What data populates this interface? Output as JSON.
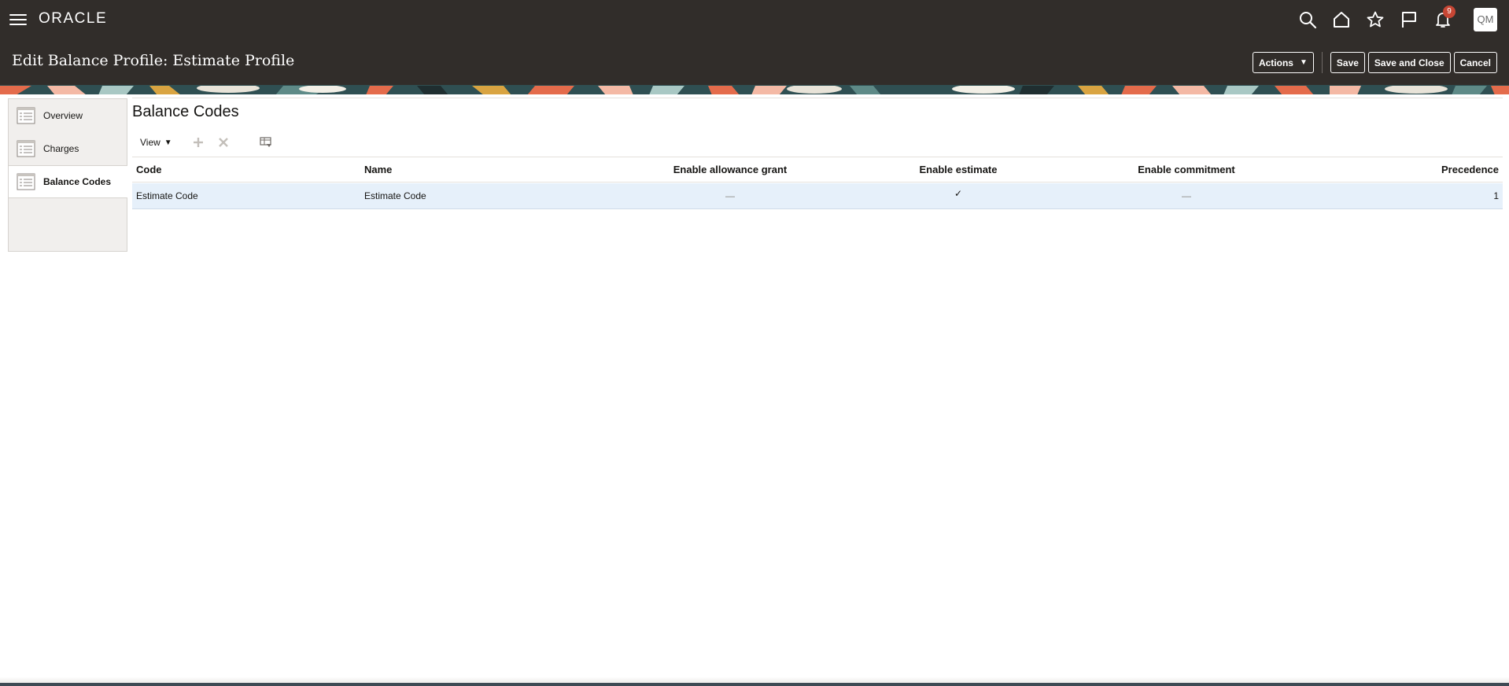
{
  "header": {
    "logo": "ORACLE",
    "notification_count": "9",
    "avatar_initials": "QM",
    "icons": [
      "search-icon",
      "home-icon",
      "favorites-star-icon",
      "flag-icon",
      "notifications-bell-icon"
    ]
  },
  "title_bar": {
    "title": "Edit Balance Profile: Estimate Profile",
    "actions_label": "Actions",
    "save_label": "Save",
    "save_close_label": "Save and Close",
    "cancel_label": "Cancel"
  },
  "left_nav": {
    "items": [
      {
        "label": "Overview"
      },
      {
        "label": "Charges"
      },
      {
        "label": "Balance Codes"
      }
    ],
    "active_index": 2
  },
  "main": {
    "section_title": "Balance Codes",
    "toolbar": {
      "view_label": "View"
    },
    "table": {
      "headers": {
        "code": "Code",
        "name": "Name",
        "allowance": "Enable allowance grant",
        "estimate": "Enable estimate",
        "commitment": "Enable commitment",
        "precedence": "Precedence"
      },
      "rows": [
        {
          "code": "Estimate Code",
          "name": "Estimate Code",
          "allowance": "—",
          "estimate": "✓",
          "commitment": "—",
          "precedence": "1"
        }
      ]
    }
  },
  "colors": {
    "header_bg": "#312d2a",
    "selected_row_bg": "#e6f0fa",
    "badge": "#c74634"
  }
}
